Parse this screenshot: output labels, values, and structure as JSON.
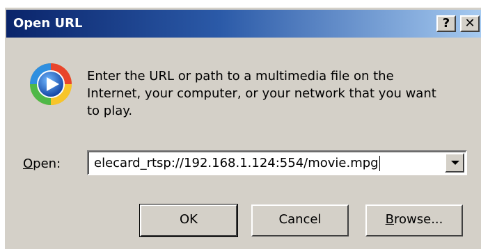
{
  "window": {
    "title": "Open URL",
    "help_glyph": "?",
    "close_glyph": "✕"
  },
  "icon": {
    "name": "windows-media-player-icon"
  },
  "message": "Enter the URL or path to a multimedia file on the Internet, your computer, or your network that you want to play.",
  "open_field": {
    "label_mnemonic": "O",
    "label_rest": "pen:",
    "value": "elecard_rtsp://192.168.1.124:554/movie.mpg"
  },
  "buttons": {
    "ok": "OK",
    "cancel": "Cancel",
    "browse_mnemonic": "B",
    "browse_rest": "rowse..."
  },
  "colors": {
    "dialog_bg": "#d4d0c8",
    "title_start": "#0a246a",
    "title_end": "#a6caf0"
  }
}
